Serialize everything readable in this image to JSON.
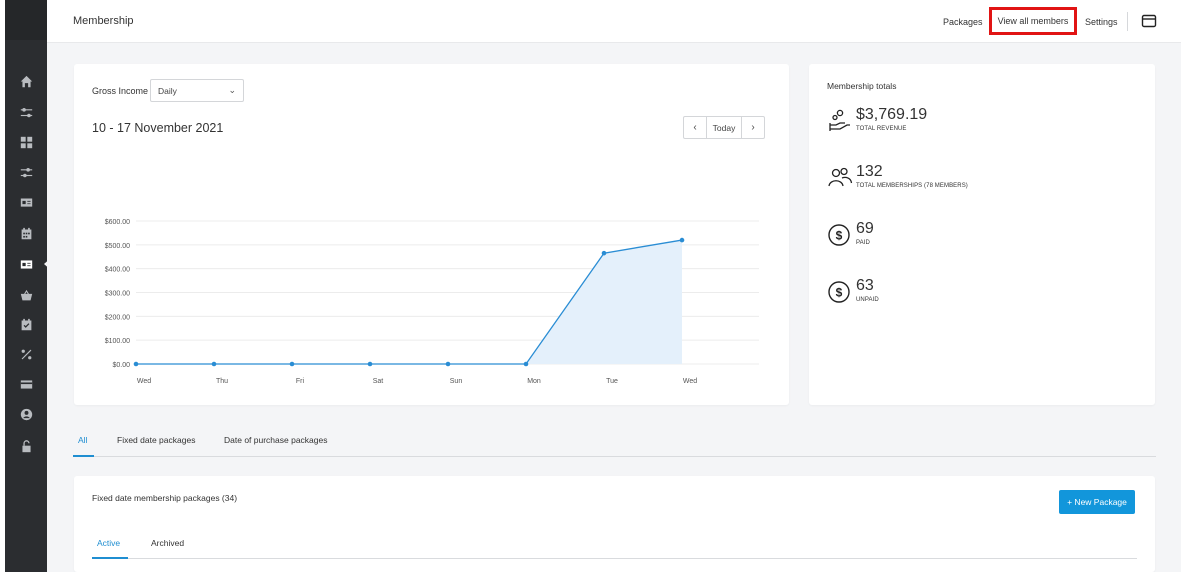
{
  "header": {
    "title": "Membership",
    "nav": {
      "packages": "Packages",
      "view_all_members": "View all members",
      "settings": "Settings"
    }
  },
  "sidebar": {
    "items": [
      {
        "icon": "home-icon"
      },
      {
        "icon": "sliders-icon"
      },
      {
        "icon": "grid-icon"
      },
      {
        "icon": "sliders-alt-icon"
      },
      {
        "icon": "id-card-icon"
      },
      {
        "icon": "calendar-icon"
      },
      {
        "icon": "membership-card-icon",
        "active": true
      },
      {
        "icon": "basket-icon"
      },
      {
        "icon": "calendar-check-icon"
      },
      {
        "icon": "percent-icon"
      },
      {
        "icon": "credit-card-icon"
      },
      {
        "icon": "user-circle-icon"
      },
      {
        "icon": "unlock-icon"
      }
    ]
  },
  "income": {
    "label": "Gross Income",
    "period_select": "Daily",
    "date_range": "10 - 17 November 2021",
    "pager": {
      "prev": "‹",
      "today": "Today",
      "next": "›"
    }
  },
  "chart_data": {
    "type": "area",
    "categories": [
      "Wed",
      "Thu",
      "Fri",
      "Sat",
      "Sun",
      "Mon",
      "Tue",
      "Wed"
    ],
    "values": [
      0,
      0,
      0,
      0,
      0,
      0,
      465,
      520
    ],
    "y_ticks": [
      "$0.00",
      "$100.00",
      "$200.00",
      "$300.00",
      "$400.00",
      "$500.00",
      "$600.00"
    ],
    "ylim": [
      0,
      600
    ],
    "grid": true,
    "colors": {
      "line": "#2a8dd4",
      "fill": "#e4f0fb",
      "grid": "#ececec"
    }
  },
  "totals": {
    "title": "Membership totals",
    "stats": [
      {
        "icon": "hand-coin-icon",
        "value": "$3,769.19",
        "label": "TOTAL REVENUE"
      },
      {
        "icon": "users-icon",
        "value": "132",
        "label": "TOTAL MEMBERSHIPS (78 MEMBERS)"
      },
      {
        "icon": "dollar-circle-icon",
        "value": "69",
        "label": "PAID"
      },
      {
        "icon": "dollar-circle-icon",
        "value": "63",
        "label": "UNPAID"
      }
    ]
  },
  "tabs": [
    "All",
    "Fixed date packages",
    "Date of purchase packages"
  ],
  "packages": {
    "title": "Fixed date membership packages (34)",
    "new_button": "+ New Package",
    "sub_tabs": [
      "Active",
      "Archived"
    ]
  },
  "colors": {
    "accent": "#1f8ed1",
    "button": "#1296db",
    "highlight": "#e11414",
    "sidebar": "#2b2d30"
  }
}
